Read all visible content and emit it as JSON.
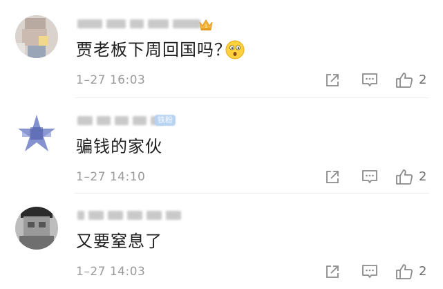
{
  "comments": [
    {
      "text": "贾老板下周回国吗？",
      "time": "1–27 16:03",
      "likes": "2",
      "badge": "crown",
      "emoji": "curious-face"
    },
    {
      "text": "骗钱的家伙",
      "time": "1–27 14:10",
      "likes": "2",
      "badge": "铁粉"
    },
    {
      "text": "又要窒息了",
      "time": "1–27 14:03",
      "likes": "2"
    }
  ],
  "icons": {
    "share": "share-icon",
    "comment": "comment-icon",
    "like": "thumbs-up-icon"
  },
  "colors": {
    "meta_gray": "#9a9a9a",
    "icon_gray": "#8a8a8a",
    "badge_blue": "#b6d3f2",
    "crown_gold": "#f2b43a"
  }
}
